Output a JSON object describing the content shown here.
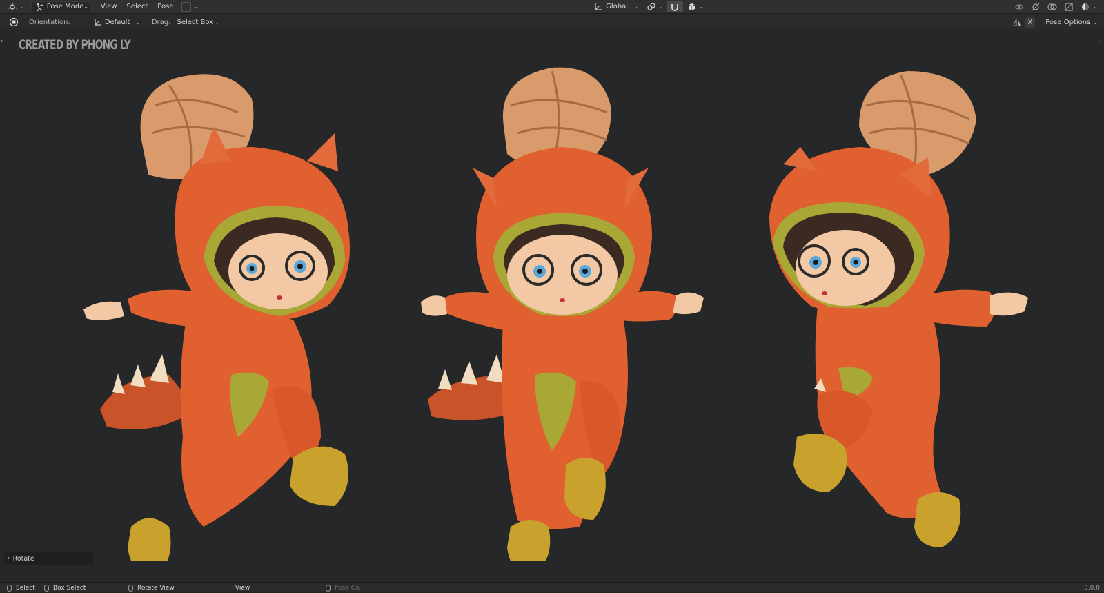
{
  "header": {
    "mode": "Pose Mode",
    "menus": [
      "View",
      "Select",
      "Pose"
    ],
    "transform_orientation": "Global",
    "mode_icon": "armature-pose-icon"
  },
  "toolbar": {
    "orientation_label": "Orientation:",
    "orientation_value": "Default",
    "drag_label": "Drag:",
    "drag_value": "Select Box",
    "x_axis": "X",
    "pose_options": "Pose Options"
  },
  "viewport": {
    "watermark": "CREATED BY PHONG LY",
    "redo_panel": "Rotate",
    "colors": {
      "suit": "#e0602f",
      "suit_dark": "#a8401c",
      "lining": "#a9a836",
      "boots": "#c9a22e",
      "hair": "#d99a6c",
      "skin": "#f2c9a4",
      "background": "#262728"
    }
  },
  "statusbar": {
    "select": "Select",
    "box_select": "Box Select",
    "rotate_view": "Rotate View",
    "view": "View",
    "pose_context": "Pose Co...",
    "version": "3.0.0"
  }
}
